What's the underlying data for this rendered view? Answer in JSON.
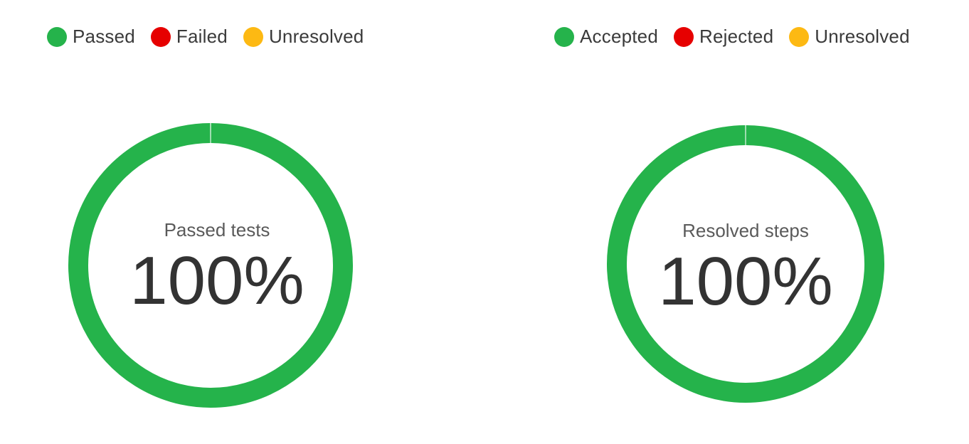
{
  "chart_data": [
    {
      "type": "pie",
      "title": "Passed tests",
      "center_value": "100%",
      "legend_placement": "top-left",
      "categories": [
        "Passed",
        "Failed",
        "Unresolved"
      ],
      "values": [
        100,
        0,
        0
      ],
      "colors": [
        "#25b34b",
        "#e60000",
        "#fdb913"
      ]
    },
    {
      "type": "pie",
      "title": "Resolved steps",
      "center_value": "100%",
      "legend_placement": "top-right",
      "categories": [
        "Accepted",
        "Rejected",
        "Unresolved"
      ],
      "values": [
        100,
        0,
        0
      ],
      "colors": [
        "#25b34b",
        "#e60000",
        "#fdb913"
      ]
    }
  ]
}
